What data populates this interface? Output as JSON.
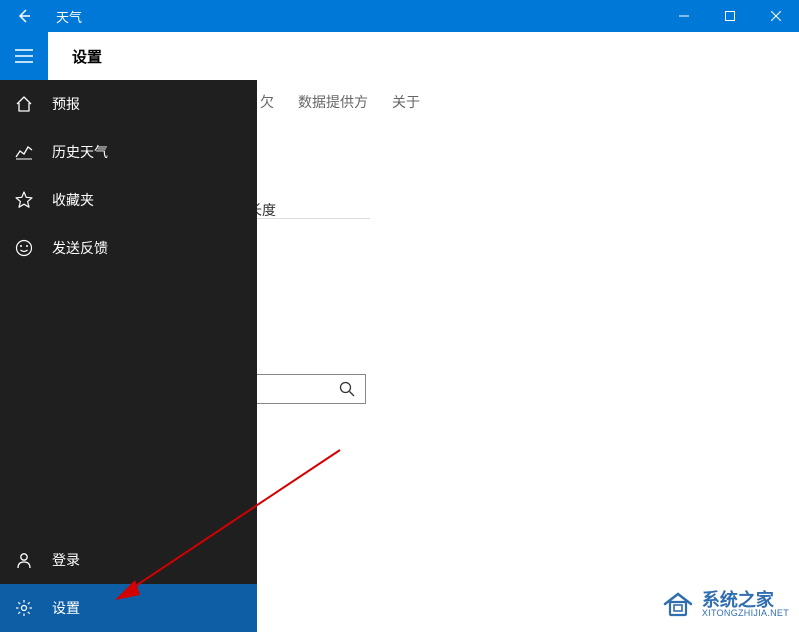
{
  "titlebar": {
    "title": "天气"
  },
  "subheader": {
    "title": "设置"
  },
  "tabs": {
    "t1_partial": "欠",
    "t2": "数据提供方",
    "t3": "关于"
  },
  "content": {
    "unit_partial": "长度"
  },
  "nav": {
    "items": [
      {
        "label": "预报"
      },
      {
        "label": "历史天气"
      },
      {
        "label": "收藏夹"
      },
      {
        "label": "发送反馈"
      }
    ],
    "bottom": [
      {
        "label": "登录"
      },
      {
        "label": "设置"
      }
    ]
  },
  "watermark": {
    "main": "系统之家",
    "sub": "XITONGZHIJIA.NET"
  }
}
